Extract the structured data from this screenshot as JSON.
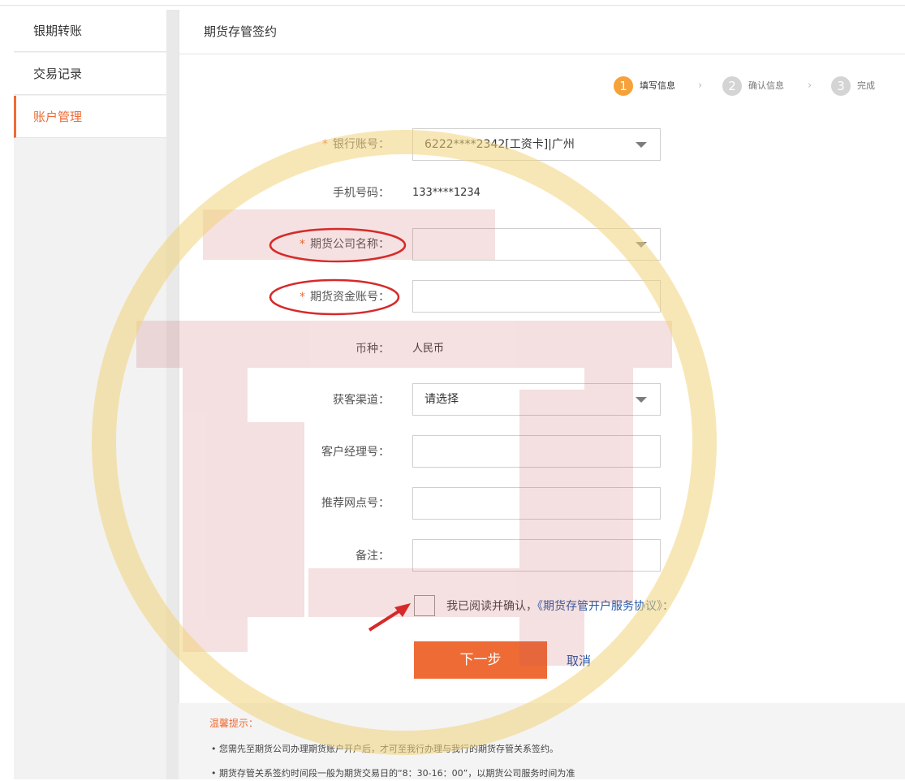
{
  "sidebar": {
    "items": [
      {
        "label": "银期转账"
      },
      {
        "label": "交易记录"
      },
      {
        "label": "账户管理",
        "active": true
      }
    ]
  },
  "header": {
    "title": "期货存管签约"
  },
  "steps": [
    {
      "num": "1",
      "label": "填写信息",
      "state": "active"
    },
    {
      "num": "2",
      "label": "确认信息",
      "state": "inactive"
    },
    {
      "num": "3",
      "label": "完成",
      "state": "inactive"
    }
  ],
  "form": {
    "bank_account": {
      "label": "银行账号：",
      "value": "6222****2342[工资卡]|广州",
      "required": true
    },
    "phone": {
      "label": "手机号码：",
      "value": "133****1234"
    },
    "futures_company": {
      "label": "期货公司名称：",
      "value": "",
      "required": true
    },
    "futures_fund_account": {
      "label": "期货资金账号：",
      "value": "",
      "required": true
    },
    "currency": {
      "label": "币种：",
      "value": "人民币"
    },
    "channel": {
      "label": "获客渠道：",
      "value": "请选择"
    },
    "manager_no": {
      "label": "客户经理号：",
      "value": ""
    },
    "branch_no": {
      "label": "推荐网点号：",
      "value": ""
    },
    "remark": {
      "label": "备注：",
      "value": ""
    },
    "required_mark": "*"
  },
  "agreement": {
    "prefix": "我已阅读并确认，",
    "link": "《期货存管开户服务协议》",
    "suffix": "："
  },
  "buttons": {
    "next": "下一步",
    "cancel": "取消"
  },
  "tips": {
    "title": "温馨提示：",
    "lines": [
      "•  您需先至期货公司办理期货账户开户后，才可至我行办理与我行的期货存管关系签约。",
      "•  期货存管关系签约时间段一般为期货交易日的“8：30-16：00”，以期货公司服务时间为准"
    ]
  },
  "colors": {
    "accent": "#ee6b36",
    "link": "#1f56a6",
    "annotation": "#d62a2a",
    "watermark_ring": "#f3d37a",
    "watermark_glyph": "#c85a5a"
  }
}
